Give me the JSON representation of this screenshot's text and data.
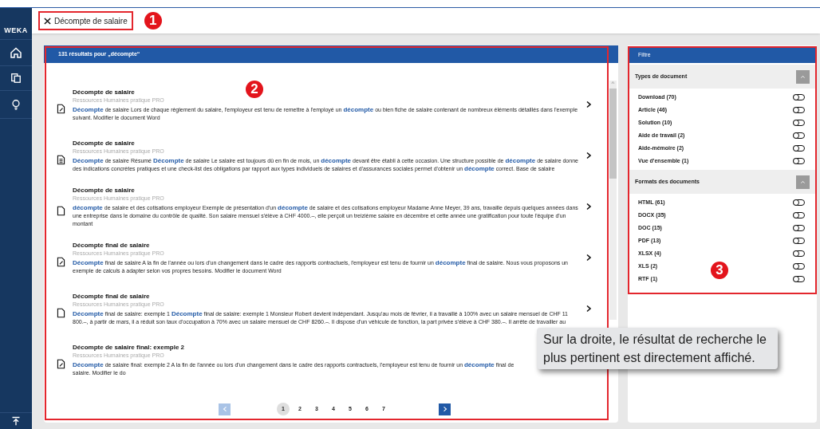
{
  "sidebar": {
    "logo": "WEKA"
  },
  "top_bar": {
    "search_tag": "Décompte de salaire"
  },
  "results": {
    "header": "131 résultats pour „décompte“",
    "items": [
      {
        "kind": "edit",
        "title": "Décompte de salaire",
        "source": "Ressources Humaines pratique PRO",
        "snippet": "**Décompte** de salaire Lors de chaque règlement du salaire, l'employeur est tenu de remettre à l'employé un **décompte** ou bien fiche de salaire contenant de nombreux éléments détaillés dans l'exemple suivant. Modifier le document Word",
        "chevron": true
      },
      {
        "kind": "text",
        "title": "Décompte de salaire",
        "source": "Ressources Humaines pratique PRO",
        "snippet": "**Décompte** de salaire Résumé **Décompte** de salaire Le salaire est toujours dû en fin de mois, un **décompte** devant être établi à cette occasion. Une structure possible de **décompte** de salaire donne des indications concrètes pratiques et une check-list des obligations par rapport aux types individuels de salaires et d'assurances sociales permet d'obtenir un **décompte** correct. Base de salaire",
        "chevron": true
      },
      {
        "kind": "blank",
        "title": "Décompte de salaire",
        "source": "Ressources Humaines pratique PRO",
        "snippet": "**décompte** de salaire et des cotisations employeur Exemple de présentation d'un **décompte** de salaire et des cotisations employeur Madame Anne Meyer, 39 ans, travaille depuis quelques années dans une entreprise dans le domaine du contrôle de qualité. Son salaire mensuel s'élève à CHF 4000.–, elle perçoit un treizième salaire en décembre et cette année une gratification pour toute l'équipe d'un montant",
        "chevron": true
      },
      {
        "kind": "edit",
        "title": "Décompte final de salaire",
        "source": "Ressources Humaines pratique PRO",
        "snippet": "**Décompte** final de salaire A la fin de l'année ou lors d'un changement dans le cadre des rapports contractuels, l'employeur est tenu de fournir un **décompte** final de salaire. Nous vous proposons un exemple de calculs à adapter selon vos propres besoins. Modifier le document Word",
        "chevron": true
      },
      {
        "kind": "blank",
        "title": "Décompte final de salaire",
        "source": "Ressources Humaines pratique PRO",
        "snippet": "**Décompte** final de salaire: exemple 1 **Décompte** final de salaire: exemple 1 Monsieur Robert devient indépendant. Jusqu'au mois de février, il a travaillé à 100% avec un salaire mensuel de CHF 11 800.–, à partir de mars, il a réduit son taux d'occupation à 70% avec un salaire mensuel de CHF 8260.–. Il dispose d'un véhicule de fonction, la part privée s'élève à CHF 380.–. Il arrête de travailler au",
        "chevron": true
      },
      {
        "kind": "edit",
        "title": "Décompte de salaire final: exemple 2",
        "source": "Ressources Humaines pratique PRO",
        "snippet": "**Décompte** de salaire final: exemple 2 A la fin de l'année ou lors d'un changement dans le cadre des rapports contractuels, l'employeur est tenu de fournir un **décompte** final de salaire. Modifier le do",
        "chevron": false
      }
    ]
  },
  "pagination": {
    "prev": {
      "disabled": true
    },
    "next": {
      "disabled": false
    },
    "pages": [
      {
        "label": "1",
        "selected": true
      },
      {
        "label": "2",
        "selected": false
      },
      {
        "label": "3",
        "selected": false
      },
      {
        "label": "4",
        "selected": false
      },
      {
        "label": "5",
        "selected": false
      },
      {
        "label": "6",
        "selected": false
      },
      {
        "label": "7",
        "selected": false
      }
    ]
  },
  "filter": {
    "title": "Filtre",
    "sections": [
      {
        "title": "Types de document",
        "expanded": true,
        "options": [
          {
            "label": "Download (70)",
            "on": false
          },
          {
            "label": "Article (46)",
            "on": false
          },
          {
            "label": "Solution (10)",
            "on": false
          },
          {
            "label": "Aide de travail (2)",
            "on": false
          },
          {
            "label": "Aide-mémoire (2)",
            "on": false
          },
          {
            "label": "Vue d'ensemble (1)",
            "on": false
          }
        ]
      },
      {
        "title": "Formats des documents",
        "expanded": true,
        "options": [
          {
            "label": "HTML (61)",
            "on": false
          },
          {
            "label": "DOCX (35)",
            "on": false
          },
          {
            "label": "DOC (15)",
            "on": false
          },
          {
            "label": "PDF (13)",
            "on": false
          },
          {
            "label": "XLSX (4)",
            "on": false
          },
          {
            "label": "XLS (2)",
            "on": false
          },
          {
            "label": "RTF (1)",
            "on": false
          }
        ]
      }
    ]
  },
  "scrollbar": {
    "up_arrow": "^"
  },
  "annotations": {
    "markers": [
      "1",
      "2",
      "3"
    ],
    "note": "Sur la droite, le résultat de recherche le plus pertinent est directement affiché."
  }
}
